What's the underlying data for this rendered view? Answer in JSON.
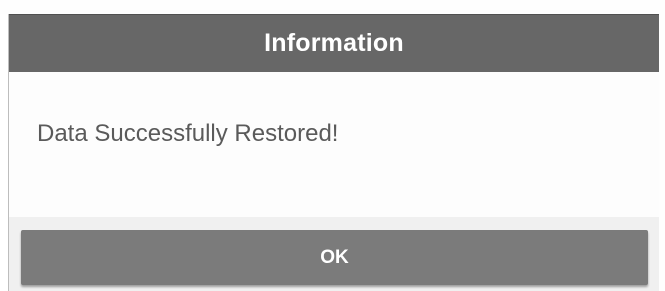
{
  "dialog": {
    "title": "Information",
    "message": "Data Successfully Restored!",
    "ok_label": "OK"
  },
  "colors": {
    "header_bg": "#676767",
    "button_bg": "#7b7b7b",
    "message_text": "#5a5a5a",
    "title_text": "#ffffff"
  }
}
